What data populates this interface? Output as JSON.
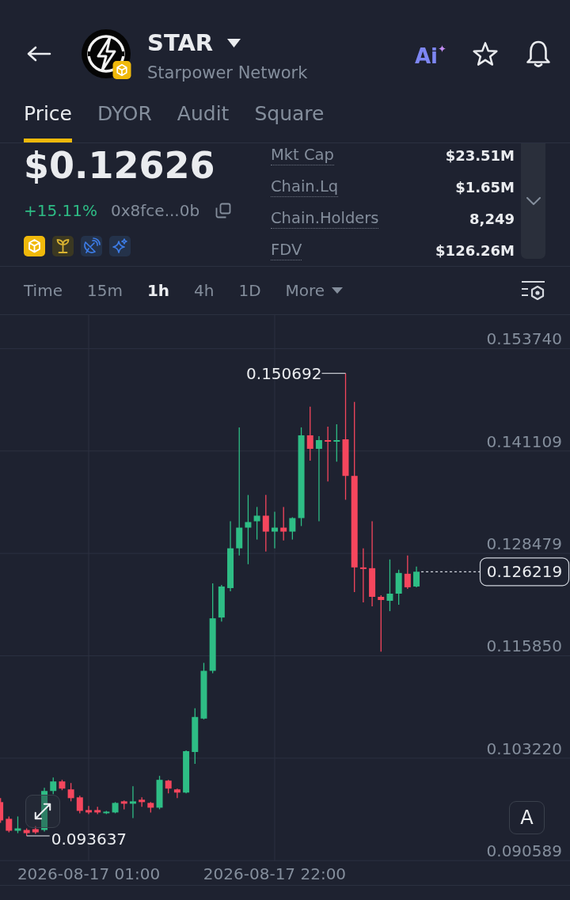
{
  "header": {
    "symbol": "STAR",
    "name": "Starpower Network",
    "ai_label": "Ai"
  },
  "tabs": [
    {
      "label": "Price",
      "selected": true
    },
    {
      "label": "DYOR",
      "selected": false
    },
    {
      "label": "Audit",
      "selected": false
    },
    {
      "label": "Square",
      "selected": false
    }
  ],
  "price": {
    "value": "$0.12626",
    "change": "+15.11%",
    "address": "0x8fce...0b"
  },
  "stats": [
    {
      "label": "Mkt Cap",
      "value": "$23.51M"
    },
    {
      "label": "Chain.Lq",
      "value": "$1.65M"
    },
    {
      "label": "Chain.Holders",
      "value": "8,249"
    },
    {
      "label": "FDV",
      "value": "$126.26M"
    }
  ],
  "stats_panel": {
    "expanded": false
  },
  "timeframes": [
    {
      "label": "Time",
      "kind": "option",
      "selected": false
    },
    {
      "label": "15m",
      "kind": "option",
      "selected": false
    },
    {
      "label": "1h",
      "kind": "option",
      "selected": true
    },
    {
      "label": "4h",
      "kind": "option",
      "selected": false
    },
    {
      "label": "1D",
      "kind": "option",
      "selected": false
    },
    {
      "label": "More",
      "kind": "dropdown",
      "selected": false
    }
  ],
  "chart": {
    "button_label": "A",
    "last_price": "0.126219",
    "chart_data": {
      "type": "candlestick",
      "grid": true,
      "categories": [
        null,
        null,
        null,
        null,
        null,
        null,
        null,
        null,
        null,
        null,
        "2026-08-17 01:00",
        null,
        null,
        null,
        null,
        null,
        null,
        null,
        null,
        null,
        null,
        null,
        null,
        null,
        null,
        null,
        null,
        null,
        null,
        null,
        null,
        "2026-08-17 22:00",
        null,
        null,
        null,
        null,
        null,
        null,
        null,
        null,
        null,
        null,
        null,
        null,
        null,
        null,
        null,
        null
      ],
      "ohlc": [
        [
          0.097801,
          0.098291,
          0.095249,
          0.095543
        ],
        [
          0.09574,
          0.096034,
          0.094071,
          0.094268
        ],
        [
          0.094268,
          0.096034,
          0.093973,
          0.094562
        ],
        [
          0.094366,
          0.094562,
          0.093637,
          0.093973
        ],
        [
          0.094464,
          0.094856,
          0.093875,
          0.094071
        ],
        [
          0.094366,
          0.099567,
          0.094169,
          0.099175
        ],
        [
          0.099175,
          0.100843,
          0.098782,
          0.100352
        ],
        [
          0.100352,
          0.100549,
          0.099273,
          0.099469
        ],
        [
          0.099371,
          0.100156,
          0.097899,
          0.098291
        ],
        [
          0.098389,
          0.098586,
          0.096427,
          0.096721
        ],
        [
          0.096819,
          0.09731,
          0.096328,
          0.096525
        ],
        [
          0.096819,
          0.097212,
          0.096328,
          0.096525
        ],
        [
          0.096427,
          0.096721,
          0.096328,
          0.096623
        ],
        [
          0.096525,
          0.097801,
          0.096427,
          0.097702
        ],
        [
          0.097899,
          0.097997,
          0.096917,
          0.097604
        ],
        [
          0.097604,
          0.099763,
          0.095838,
          0.097899
        ],
        [
          0.098095,
          0.098389,
          0.097212,
          0.097801
        ],
        [
          0.097702,
          0.097801,
          0.096525,
          0.097114
        ],
        [
          0.097114,
          0.101039,
          0.096917,
          0.100549
        ],
        [
          0.10045,
          0.100549,
          0.09888,
          0.099469
        ],
        [
          0.099371,
          0.099469,
          0.098291,
          0.098978
        ],
        [
          0.098978,
          0.10418,
          0.09888,
          0.104082
        ],
        [
          0.103983,
          0.109381,
          0.102511,
          0.108302
        ],
        [
          0.108105,
          0.114975,
          0.108007,
          0.113994
        ],
        [
          0.113994,
          0.124789,
          0.113699,
          0.120471
        ],
        [
          0.120569,
          0.124593,
          0.120078,
          0.124397
        ],
        [
          0.1242,
          0.132444,
          0.123808,
          0.129107
        ],
        [
          0.129107,
          0.144025,
          0.128224,
          0.131659
        ],
        [
          0.131659,
          0.135683,
          0.127144,
          0.132346
        ],
        [
          0.132444,
          0.134211,
          0.130187,
          0.133131
        ],
        [
          0.133131,
          0.135683,
          0.128715,
          0.131168
        ],
        [
          0.131168,
          0.133622,
          0.129107,
          0.131659
        ],
        [
          0.131659,
          0.134211,
          0.130089,
          0.131168
        ],
        [
          0.131168,
          0.132935,
          0.130187,
          0.132837
        ],
        [
          0.132837,
          0.144025,
          0.131855,
          0.143043
        ],
        [
          0.143043,
          0.146576,
          0.139903,
          0.141375
        ],
        [
          0.141375,
          0.142945,
          0.132444,
          0.142454
        ],
        [
          0.142454,
          0.144123,
          0.137351,
          0.142258
        ],
        [
          0.142258,
          0.144417,
          0.139805,
          0.142454
        ],
        [
          0.142552,
          0.150692,
          0.135094,
          0.138038
        ],
        [
          0.138038,
          0.147165,
          0.12371,
          0.126752
        ],
        [
          0.126752,
          0.129107,
          0.122434,
          0.126556
        ],
        [
          0.126654,
          0.132444,
          0.121943,
          0.123121
        ],
        [
          0.123121,
          0.123317,
          0.116349,
          0.122728
        ],
        [
          0.12263,
          0.127733,
          0.121354,
          0.123513
        ],
        [
          0.123513,
          0.126457,
          0.122139,
          0.126065
        ],
        [
          0.125967,
          0.128224,
          0.124102,
          0.124298
        ],
        [
          0.124397,
          0.12685,
          0.124298,
          0.126219
        ]
      ],
      "ylim": [
        0.090511,
        0.15788
      ],
      "yticks": [
        {
          "value": 0.15374,
          "label": "0.153740"
        },
        {
          "value": 0.141109,
          "label": "0.141109"
        },
        {
          "value": 0.128479,
          "label": "0.128479"
        },
        {
          "value": 0.11585,
          "label": "0.115850"
        },
        {
          "value": 0.10322,
          "label": "0.103220"
        },
        {
          "value": 0.090589,
          "label": "0.090589"
        }
      ],
      "annotations": [
        "0.150692",
        "0.093637"
      ]
    }
  }
}
